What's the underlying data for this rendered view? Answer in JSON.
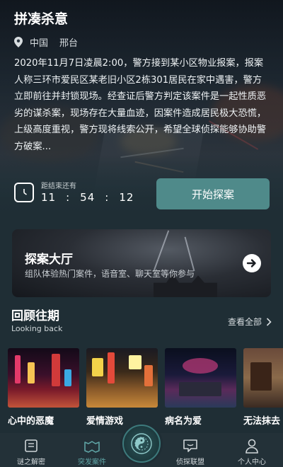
{
  "hero": {
    "title": "拼凑杀意",
    "country": "中国",
    "city": "邢台",
    "description": "2020年11月7日凌晨2:00，警方接到某小区物业报案，报案人称三环市爱民区某老旧小区2栋301居民在家中遇害，警方立即前往并封锁现场。经查证后警方判定该案件是一起性质恶劣的谋杀案，现场存在大量血迹，因案件造成居民极大恐慌，上级高度重视，警方现将线索公开，希望全球侦探能够协助警方破案..."
  },
  "countdown": {
    "label": "距结束还有",
    "hours": "11",
    "minutes": "54",
    "seconds": "12",
    "separator": ":"
  },
  "start_button": "开始探案",
  "hall": {
    "title": "探案大厅",
    "subtitle": "组队体验热门案件，语音室、聊天室等你参与"
  },
  "review": {
    "title": "回顾往期",
    "subtitle": "Looking back",
    "see_all": "查看全部",
    "cards": [
      {
        "caption": "心中的恶魔"
      },
      {
        "caption": "爱情游戏"
      },
      {
        "caption": "病名为爱"
      },
      {
        "caption": "无法抹去"
      }
    ]
  },
  "nav": {
    "items": [
      {
        "label": "谜之解密",
        "icon": "book-icon"
      },
      {
        "label": "突发案件",
        "icon": "case-icon"
      },
      {
        "label": "侦探联盟",
        "icon": "chat-icon"
      },
      {
        "label": "个人中心",
        "icon": "user-icon"
      }
    ],
    "center_icon": "compass-icon"
  },
  "colors": {
    "background": "#1f2e35",
    "accent": "#4f8a8a",
    "nav_active": "#5fa4a5"
  }
}
